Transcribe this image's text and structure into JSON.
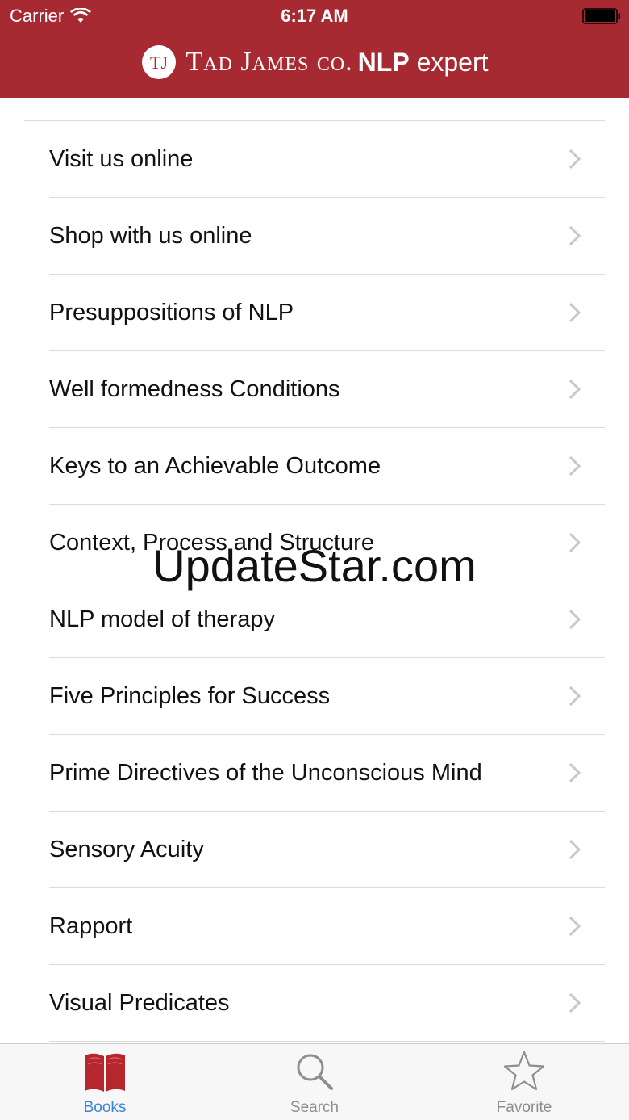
{
  "status_bar": {
    "carrier": "Carrier",
    "time": "6:17 AM"
  },
  "header": {
    "logo_text": "TJ",
    "brand_name": "Tad James co.",
    "brand_suffix_bold": "NLP",
    "brand_suffix_light": " expert"
  },
  "menu": {
    "items": [
      {
        "label": "Visit us online"
      },
      {
        "label": "Shop with us online"
      },
      {
        "label": "Presuppositions of NLP"
      },
      {
        "label": "Well formedness Conditions"
      },
      {
        "label": "Keys to an Achievable Outcome"
      },
      {
        "label": "Context, Process and Structure"
      },
      {
        "label": "NLP model of therapy"
      },
      {
        "label": "Five Principles for Success"
      },
      {
        "label": "Prime Directives of the Unconscious Mind"
      },
      {
        "label": "Sensory Acuity"
      },
      {
        "label": "Rapport"
      },
      {
        "label": "Visual Predicates"
      }
    ]
  },
  "watermark": "UpdateStar.com",
  "tabbar": {
    "tabs": [
      {
        "label": "Books",
        "icon": "book-icon",
        "active": true
      },
      {
        "label": "Search",
        "icon": "search-icon",
        "active": false
      },
      {
        "label": "Favorite",
        "icon": "star-icon",
        "active": false
      }
    ]
  },
  "colors": {
    "header_bg": "#a72a32",
    "tab_active": "#3b82d8",
    "tab_inactive": "#8e8e8e",
    "book_icon": "#b5262d"
  }
}
